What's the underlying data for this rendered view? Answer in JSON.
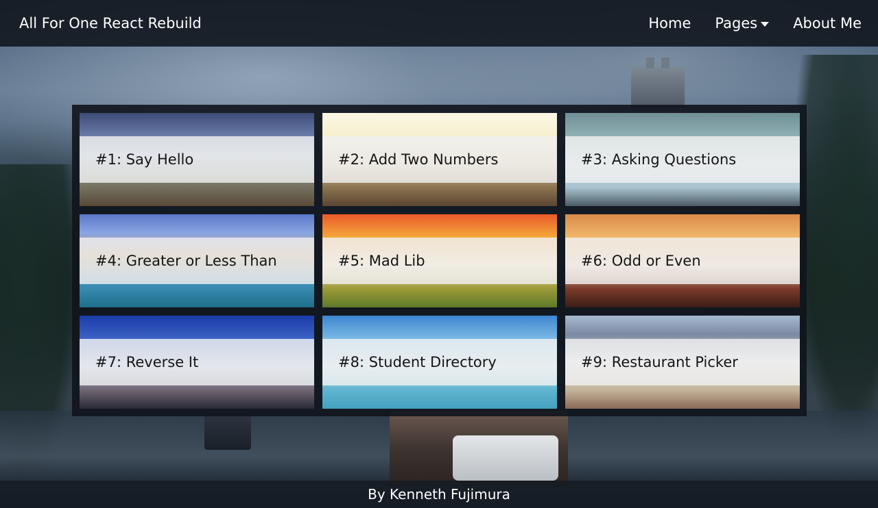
{
  "navbar": {
    "brand": "All For One React Rebuild",
    "links": {
      "home": "Home",
      "pages": "Pages",
      "about": "About Me"
    }
  },
  "cards": [
    {
      "label": "#1: Say Hello"
    },
    {
      "label": "#2: Add Two Numbers"
    },
    {
      "label": "#3: Asking Questions"
    },
    {
      "label": "#4: Greater or Less Than"
    },
    {
      "label": "#5: Mad Lib"
    },
    {
      "label": "#6: Odd or Even"
    },
    {
      "label": "#7: Reverse It"
    },
    {
      "label": "#8: Student Directory"
    },
    {
      "label": "#9: Restaurant Picker"
    }
  ],
  "footer": {
    "text": "By Kenneth Fujimura"
  }
}
